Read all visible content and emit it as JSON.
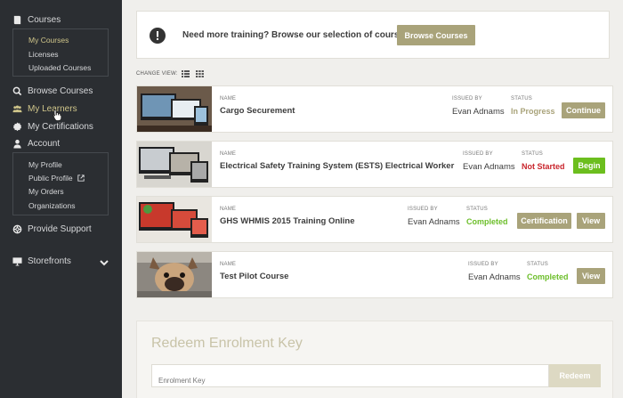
{
  "sidebar": {
    "courses": "Courses",
    "courses_sub": [
      "My Courses",
      "Licenses",
      "Uploaded Courses"
    ],
    "browse_courses": "Browse Courses",
    "my_learners": "My Learners",
    "my_certifications": "My Certifications",
    "account": "Account",
    "account_sub": [
      "My Profile",
      "Public Profile",
      "My Orders",
      "Organizations"
    ],
    "provide_support": "Provide Support",
    "storefronts": "Storefronts"
  },
  "banner": {
    "message": "Need more training? Browse our selection of courses.",
    "button": "Browse Courses"
  },
  "change_view": "CHANGE VIEW:",
  "labels": {
    "name": "NAME",
    "issued_by": "ISSUED BY",
    "status": "STATUS"
  },
  "courses": [
    {
      "name": "Cargo Securement",
      "issued_by": "Evan Adnams",
      "status": "In Progress",
      "actions": [
        "Continue"
      ]
    },
    {
      "name": "Electrical Safety Training System (ESTS) Electrical Worker",
      "issued_by": "Evan Adnams",
      "status": "Not Started",
      "actions": [
        "Begin"
      ]
    },
    {
      "name": "GHS WHMIS 2015 Training Online",
      "issued_by": "Evan Adnams",
      "status": "Completed",
      "actions": [
        "Certification",
        "View"
      ]
    },
    {
      "name": "Test Pilot Course",
      "issued_by": "Evan Adnams",
      "status": "Completed",
      "actions": [
        "View"
      ]
    }
  ],
  "redeem": {
    "title": "Redeem Enrolment Key",
    "placeholder": "Enrolment Key",
    "button": "Redeem"
  },
  "colors": {
    "sidebar_bg": "#2b2e32",
    "accent": "#cfc58a",
    "gold_button": "#a9a37a",
    "green": "#6cbe2a",
    "red": "#c9252c"
  }
}
